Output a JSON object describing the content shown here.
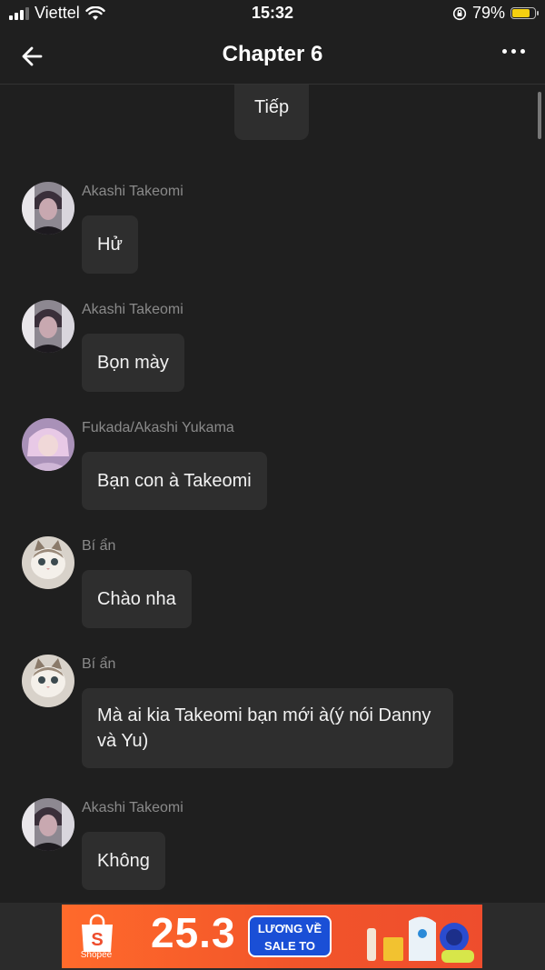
{
  "status_bar": {
    "carrier": "Viettel",
    "time": "15:32",
    "battery_percent": "79%",
    "battery_level": 0.79,
    "battery_color": "#f5d010"
  },
  "nav": {
    "title": "Chapter 6",
    "back_icon": "arrow-left-icon",
    "more_icon": "more-dots-icon"
  },
  "top_message": "Tiếp",
  "messages": [
    {
      "sender": "Akashi Takeomi",
      "text": "Hử",
      "avatar": "dark-hair-character-avatar"
    },
    {
      "sender": "Akashi Takeomi",
      "text": "Bọn mày",
      "avatar": "dark-hair-character-avatar"
    },
    {
      "sender": "Fukada/Akashi Yukama",
      "text": "Bạn con à Takeomi",
      "avatar": "pink-hair-character-avatar"
    },
    {
      "sender": "Bí ẩn",
      "text": "Chào nha",
      "avatar": "cat-avatar"
    },
    {
      "sender": "Bí ẩn",
      "text": "Mà ai kia Takeomi bạn mới à(ý nói Danny và Yu)",
      "avatar": "cat-avatar"
    },
    {
      "sender": "Akashi Takeomi",
      "text": "Không",
      "avatar": "dark-hair-character-avatar"
    }
  ],
  "ad": {
    "brand": "Shopee",
    "number": "25.3",
    "pill_line1": "LƯƠNG VỀ",
    "pill_line2": "SALE TO"
  },
  "colors": {
    "background": "#1f1f1f",
    "bubble": "#2e2e2e",
    "sender_text": "#8a8a8a",
    "ad_orange": "#ee4d2d"
  }
}
